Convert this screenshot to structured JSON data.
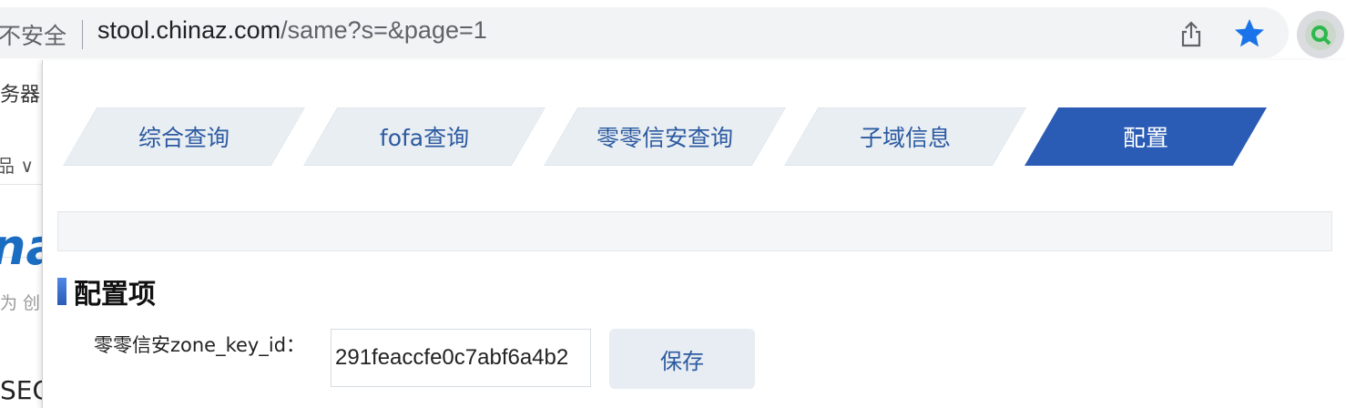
{
  "browser": {
    "security_label": "不安全",
    "url_host": "stool.chinaz.com",
    "url_path": "/same?s=&page=1",
    "colors": {
      "star": "#1a73e8"
    }
  },
  "background_page": {
    "text_1": "务器",
    "text_2": "品 ∨",
    "logo_fragment": "na",
    "tagline_fragment": "为 创",
    "text_3": "SEO"
  },
  "popup": {
    "tabs": [
      {
        "label": "综合查询",
        "active": false
      },
      {
        "label": "fofa查询",
        "active": false
      },
      {
        "label": "零零信安查询",
        "active": false
      },
      {
        "label": "子域信息",
        "active": false
      },
      {
        "label": "配置",
        "active": true
      }
    ],
    "section_title": "配置项",
    "field_label": "零零信安zone_key_id：",
    "field_value": "291feaccfe0c7abf6a4b2",
    "save_label": "保存",
    "colors": {
      "active_tab": "#2b5cb5",
      "inactive_tab": "#e9eef3",
      "tab_text": "#2c5aa0"
    }
  }
}
